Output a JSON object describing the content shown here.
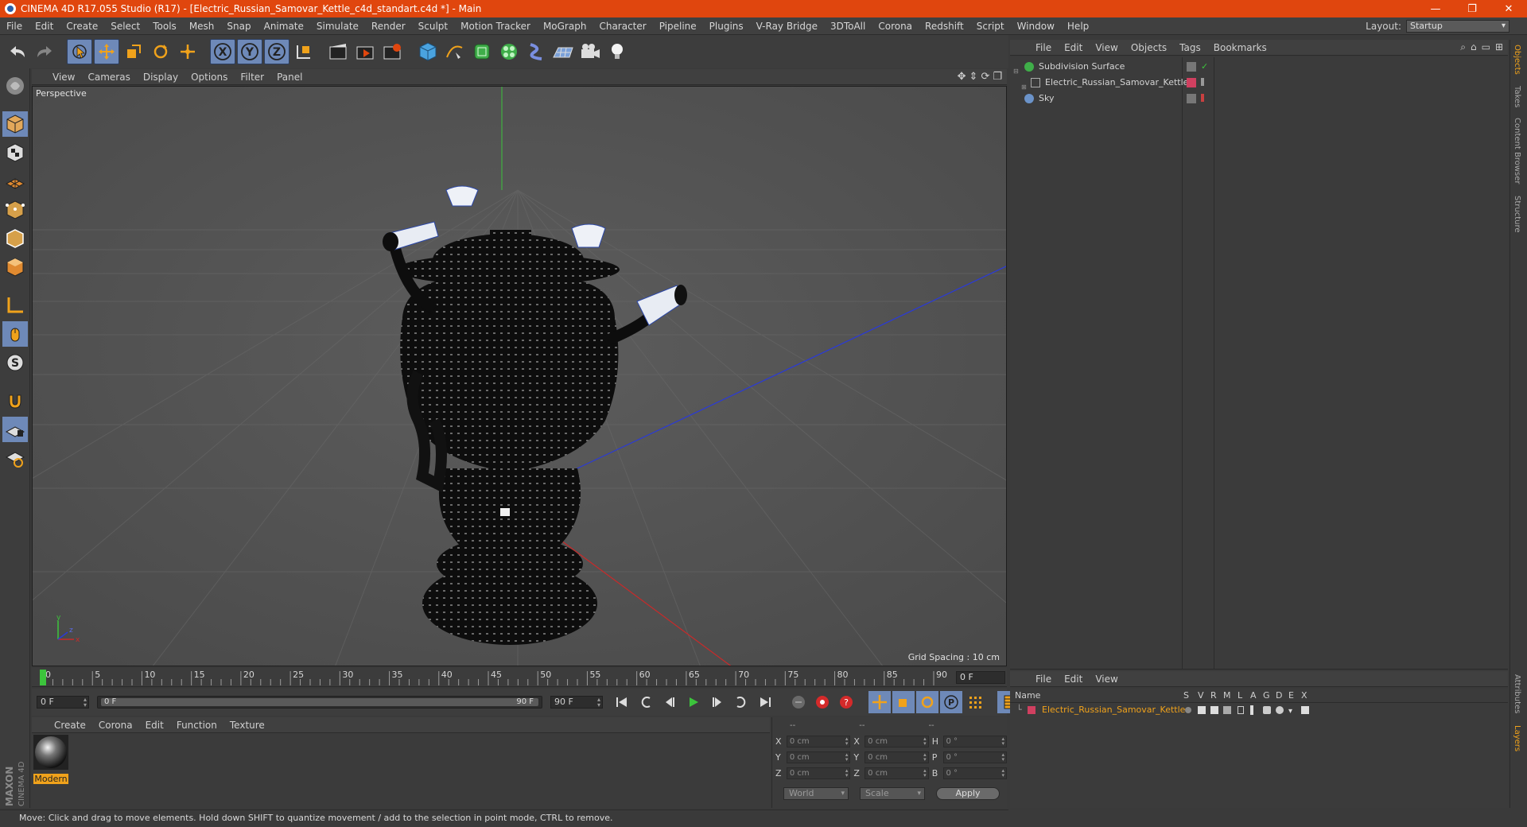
{
  "window": {
    "title": "CINEMA 4D R17.055 Studio (R17) - [Electric_Russian_Samovar_Kettle_c4d_standart.c4d *] - Main",
    "minimize": "—",
    "maximize": "❐",
    "close": "✕"
  },
  "menubar": {
    "items": [
      "File",
      "Edit",
      "Create",
      "Select",
      "Tools",
      "Mesh",
      "Snap",
      "Animate",
      "Simulate",
      "Render",
      "Sculpt",
      "Motion Tracker",
      "MoGraph",
      "Character",
      "Pipeline",
      "Plugins",
      "V-Ray Bridge",
      "3DToAll",
      "Corona",
      "Redshift",
      "Script",
      "Window",
      "Help"
    ],
    "layout_label": "Layout:",
    "layout_value": "Startup"
  },
  "viewport": {
    "menu": [
      "View",
      "Cameras",
      "Display",
      "Options",
      "Filter",
      "Panel"
    ],
    "label": "Perspective",
    "grid_spacing": "Grid Spacing : 10 cm",
    "axis_x": "x",
    "axis_y": "y",
    "axis_z": "z"
  },
  "timeline": {
    "ticks": [
      "0",
      "5",
      "10",
      "15",
      "20",
      "25",
      "30",
      "35",
      "40",
      "45",
      "50",
      "55",
      "60",
      "65",
      "70",
      "75",
      "80",
      "85",
      "90"
    ],
    "current_frame_box": "0 F",
    "start_field": "0 F",
    "range_start": "0 F",
    "range_end": "90 F",
    "end_field": "90 F"
  },
  "material_manager": {
    "menu": [
      "Create",
      "Corona",
      "Edit",
      "Function",
      "Texture"
    ],
    "material_name": "Modern"
  },
  "coordinates": {
    "headers": [
      "--",
      "--",
      "--"
    ],
    "rows": [
      {
        "a": "X",
        "av": "0 cm",
        "b": "X",
        "bv": "0 cm",
        "c": "H",
        "cv": "0 °"
      },
      {
        "a": "Y",
        "av": "0 cm",
        "b": "Y",
        "bv": "0 cm",
        "c": "P",
        "cv": "0 °"
      },
      {
        "a": "Z",
        "av": "0 cm",
        "b": "Z",
        "bv": "0 cm",
        "c": "B",
        "cv": "0 °"
      }
    ],
    "mode": "World",
    "scale": "Scale",
    "apply": "Apply"
  },
  "status": {
    "text": "Move: Click and drag to move elements. Hold down SHIFT to quantize movement / add to the selection in point mode, CTRL to remove."
  },
  "object_manager": {
    "menu": [
      "File",
      "Edit",
      "View",
      "Objects",
      "Tags",
      "Bookmarks"
    ],
    "objects": [
      {
        "name": "Subdivision Surface"
      },
      {
        "name": "Electric_Russian_Samovar_Kettle"
      },
      {
        "name": "Sky"
      }
    ]
  },
  "side_tabs": [
    "Objects",
    "Takes",
    "Content Browser",
    "Structure",
    "Attributes",
    "Layers"
  ],
  "layer_manager": {
    "menu": [
      "File",
      "Edit",
      "View"
    ],
    "header_name": "Name",
    "header_cols": [
      "S",
      "V",
      "R",
      "M",
      "L",
      "A",
      "G",
      "D",
      "E",
      "X"
    ],
    "layers": [
      {
        "name": "Electric_Russian_Samovar_Kettle"
      }
    ]
  },
  "colors": {
    "titlebar": "#e0460e",
    "active_blue": "#6e89b8",
    "accent_orange": "#f0a21b",
    "viewport_bg": "#555555",
    "layer_red": "#d04060"
  }
}
